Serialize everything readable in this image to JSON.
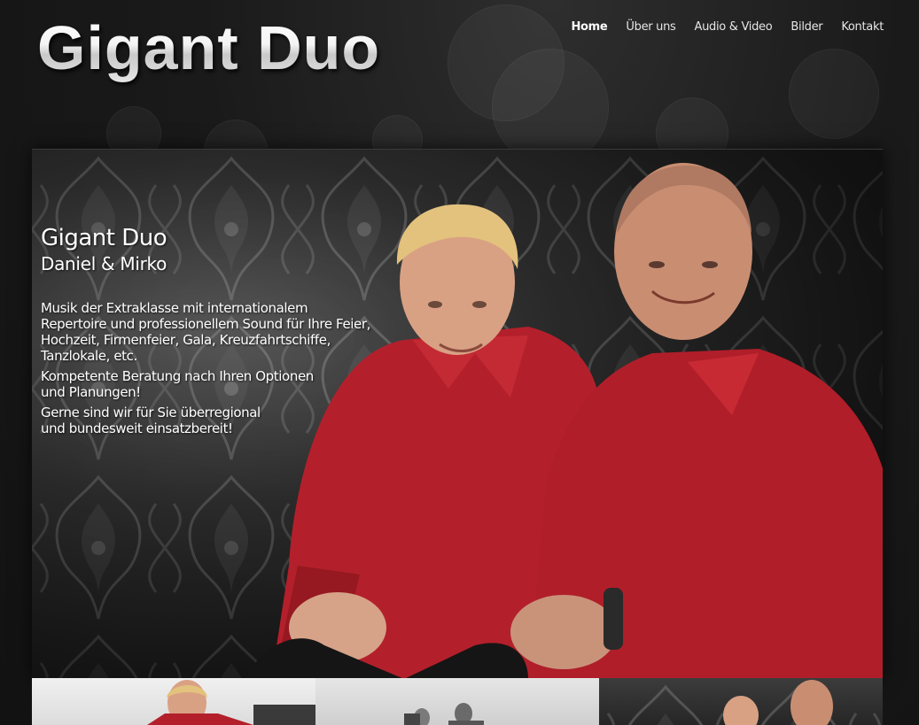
{
  "header": {
    "logo_text": "Gigant Duo"
  },
  "nav": {
    "items": [
      {
        "label": "Home",
        "active": true
      },
      {
        "label": "Über uns",
        "active": false
      },
      {
        "label": "Audio & Video",
        "active": false
      },
      {
        "label": "Bilder",
        "active": false
      },
      {
        "label": "Kontakt",
        "active": false
      }
    ]
  },
  "hero": {
    "title": "Gigant Duo",
    "subtitle": "Daniel & Mirko",
    "paragraph_1_line_1": "Musik der Extraklasse mit internationalem",
    "paragraph_1_line_2": "Repertoire und professionellem Sound für Ihre Feier,",
    "paragraph_1_line_3": "Hochzeit, Firmenfeier, Gala, Kreuzfahrtschiffe,",
    "paragraph_1_line_4": "Tanzlokale, etc.",
    "paragraph_2_line_1": "Kompetente Beratung nach Ihren Optionen",
    "paragraph_2_line_2": "und Planungen!",
    "paragraph_3_line_1": "Gerne sind wir für Sie überregional",
    "paragraph_3_line_2": "und bundesweit einsatzbereit!"
  },
  "colors": {
    "background": "#141414",
    "shirt_red": "#b5202a",
    "text": "#ffffff"
  }
}
